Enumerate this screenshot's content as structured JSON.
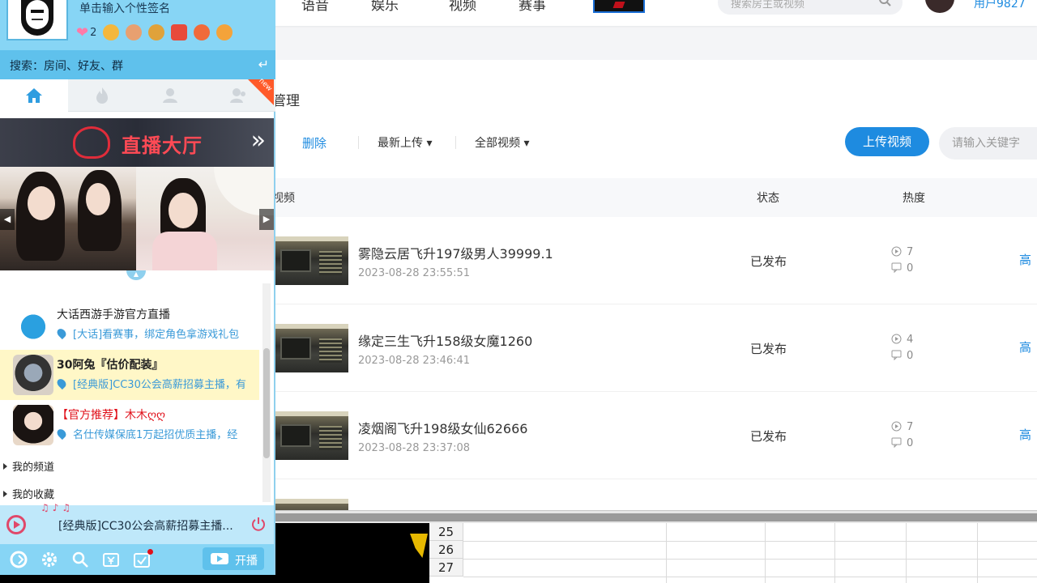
{
  "website": {
    "nav": {
      "items": [
        "语音",
        "娱乐",
        "视频",
        "赛事"
      ],
      "search_placeholder": "搜索房主或视频",
      "user_label": "用户9827"
    },
    "management": {
      "title": "管理",
      "delete_label": "删除",
      "filter_sort": "最新上传",
      "filter_scope": "全部视频",
      "upload_label": "上传视频",
      "search_placeholder": "请输入关键字",
      "columns": {
        "video": "视频",
        "status": "状态",
        "heat": "热度"
      },
      "rows": [
        {
          "title": "雾隐云居飞升197级男人39999.1",
          "date": "2023-08-28 23:55:51",
          "status": "已发布",
          "plays": "7",
          "comments": "0",
          "more": "高"
        },
        {
          "title": "缘定三生飞升158级女魔1260",
          "date": "2023-08-28 23:46:41",
          "status": "已发布",
          "plays": "4",
          "comments": "0",
          "more": "高"
        },
        {
          "title": "凌烟阁飞升198级女仙62666",
          "date": "2023-08-28 23:37:08",
          "status": "已发布",
          "plays": "7",
          "comments": "0",
          "more": "高"
        }
      ]
    }
  },
  "spreadsheet": {
    "row_numbers": [
      "25",
      "26",
      "27"
    ]
  },
  "cc_panel": {
    "signature_placeholder": "单击输入个性签名",
    "heart_count": "2",
    "search_text": "搜索：房间、好友、群",
    "new_flag": "new",
    "banner_text": "直播大厅",
    "list": [
      {
        "title": "大话西游手游官方直播",
        "subtitle": "[大话]看赛事，绑定角色拿游戏礼包",
        "recommend": ""
      },
      {
        "title": "30阿兔『估价配装』",
        "subtitle": "[经典版]CC30公会高薪招募主播，有",
        "recommend": ""
      },
      {
        "title": "木木ღღ",
        "subtitle": "名仕传媒保底1万起招优质主播，经",
        "recommend": "【官方推荐】"
      }
    ],
    "sections": [
      "我的频道",
      "我的收藏"
    ],
    "now_playing": "[经典版]CC30公会高薪招募主播...",
    "live_button": "开播"
  },
  "colors": {
    "accent": "#1e8be0",
    "panel_blue": "#87d5f5",
    "search_blue": "#5fc1ec",
    "highlight": "#fff7c7"
  }
}
